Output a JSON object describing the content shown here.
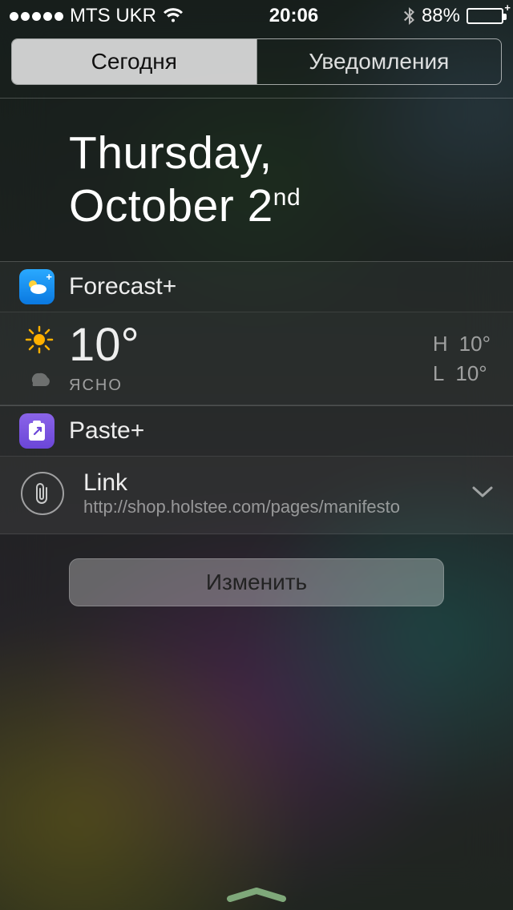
{
  "status_bar": {
    "carrier": "MTS UKR",
    "time": "20:06",
    "battery_pct": "88%",
    "battery_fill_pct": 88
  },
  "tabs": {
    "today": "Сегодня",
    "notifications": "Уведомления"
  },
  "date": {
    "line1": "Thursday,",
    "line2_a": "October 2",
    "line2_sup": "nd"
  },
  "forecast": {
    "widget_name": "Forecast+",
    "temp": "10°",
    "condition": "ясно",
    "high_label": "H",
    "high_value": "10°",
    "low_label": "L",
    "low_value": "10°"
  },
  "paste": {
    "widget_name": "Paste+",
    "item_title": "Link",
    "item_url": "http://shop.holstee.com/pages/manifesto"
  },
  "edit_button": "Изменить"
}
